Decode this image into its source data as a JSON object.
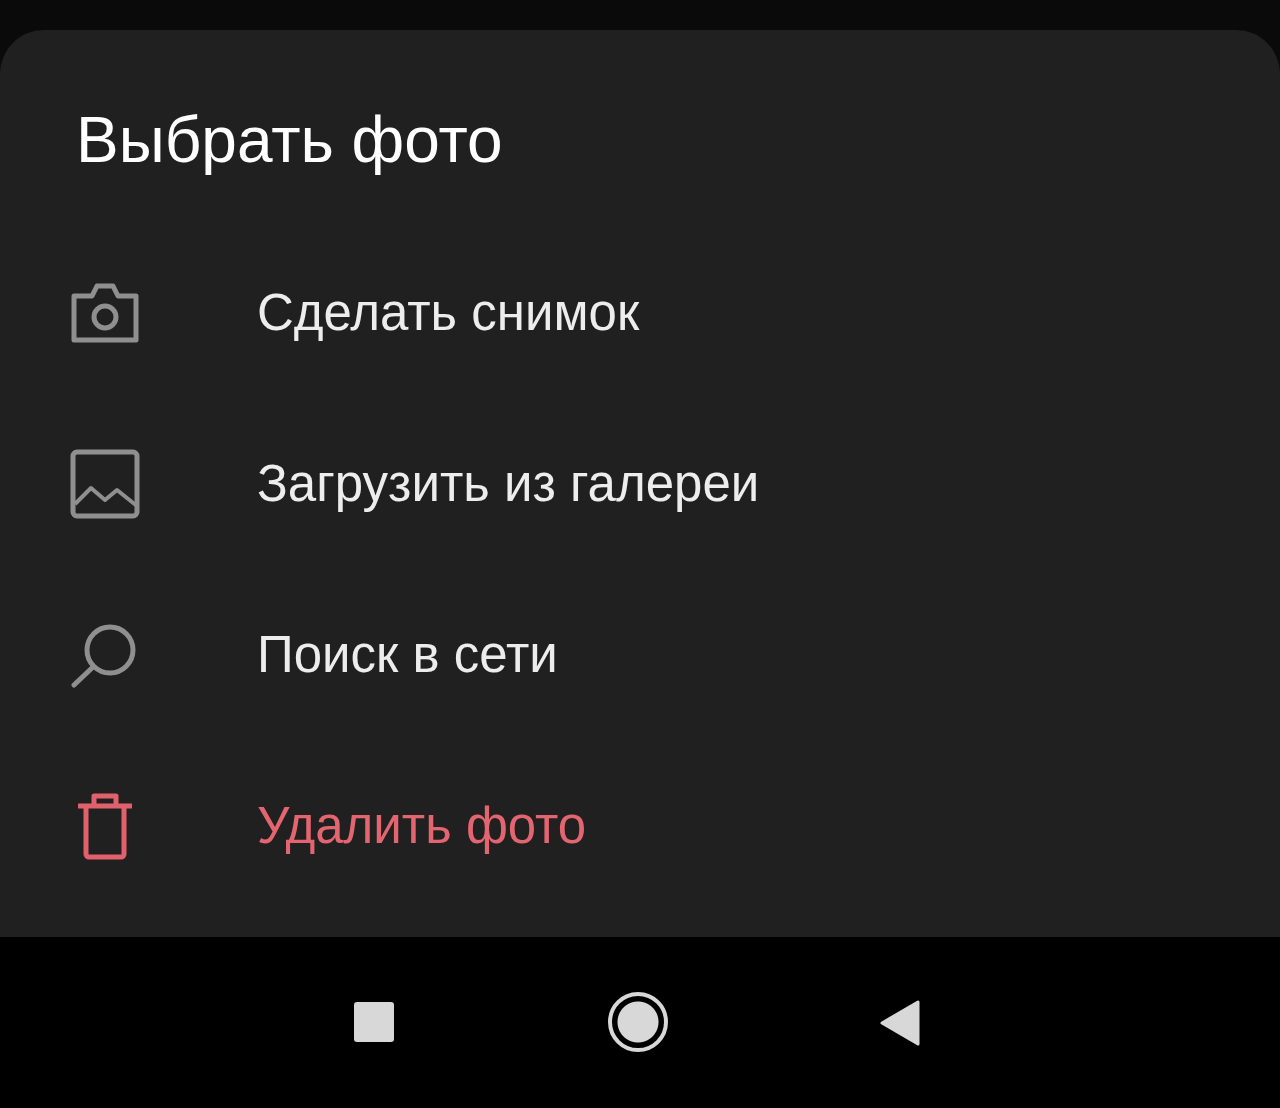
{
  "sheet": {
    "title": "Выбрать фото",
    "items": [
      {
        "kind": "camera",
        "label": "Сделать снимок",
        "destructive": false
      },
      {
        "kind": "gallery",
        "label": "Загрузить из галереи",
        "destructive": false
      },
      {
        "kind": "search",
        "label": "Поиск в сети",
        "destructive": false
      },
      {
        "kind": "trash",
        "label": "Удалить фото",
        "destructive": true
      }
    ]
  }
}
